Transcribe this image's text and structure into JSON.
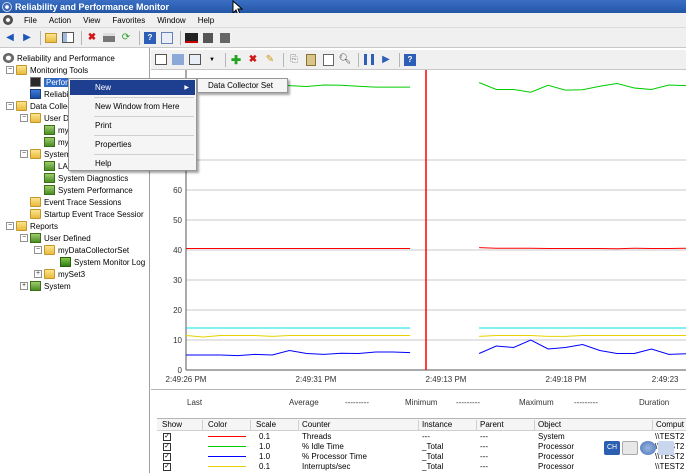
{
  "window": {
    "title": "Reliability and Performance Monitor"
  },
  "menubar": [
    "File",
    "Action",
    "View",
    "Favorites",
    "Window",
    "Help"
  ],
  "tree": {
    "root": "Reliability and Performance",
    "monitoring_tools": "Monitoring Tools",
    "performance": "Performa",
    "reliability": "Reliability",
    "data_collector_sets": "Data Collector",
    "user_defined": "User Defin",
    "my_data": "myDa",
    "my_set": "mySe",
    "system": "System",
    "lan_diag": "LAN D",
    "system_diagnostics": "System Diagnostics",
    "system_performance": "System Performance",
    "event_trace": "Event Trace Sessions",
    "startup_trace": "Startup Event Trace Sessior",
    "reports": "Reports",
    "reports_user_defined": "User Defined",
    "reports_mydcs": "myDataCollectorSet",
    "reports_sys_monitor_log": "System Monitor Log",
    "reports_myset3": "mySet3",
    "reports_system": "System"
  },
  "context_menu": {
    "items": [
      "New",
      "New Window from Here",
      "Print",
      "Properties",
      "Help"
    ],
    "submenu": "Data Collector Set"
  },
  "chart_data": {
    "type": "line",
    "y_tick_labels": [
      "70",
      "60",
      "50",
      "40",
      "30",
      "20",
      "10",
      "0"
    ],
    "ylim": [
      0,
      100
    ],
    "x_tick_labels": [
      "2:49:26 PM",
      "2:49:31 PM",
      "2:49:13 PM",
      "2:49:18 PM",
      "2:49:23"
    ],
    "series": [
      {
        "name": "Threads",
        "color": "#ff0000",
        "values": [
          40.5,
          40.5,
          40.5,
          40.5,
          40.5,
          40.5,
          40.5,
          40.5,
          40.5,
          40.5,
          40.5,
          40.5,
          40.5,
          40.5,
          40.5,
          40.5,
          40.5,
          40.8,
          40.6,
          40.6,
          40.6,
          40.5,
          40.5,
          40.5,
          40.5,
          40.4,
          40.6,
          40.5,
          40.5,
          40.6
        ]
      },
      {
        "name": "% Idle Time",
        "color": "#00cc00",
        "values": [
          95.5,
          94.5,
          94.8,
          95.2,
          94.6,
          95.8,
          94.8,
          94.5,
          95.0,
          94.9,
          94.6,
          94.3,
          94.3,
          94.3,
          94.3,
          95.0,
          92.0,
          95.8,
          93.5,
          93.5,
          92.6,
          94.9,
          93.3,
          93.4,
          94.6,
          95.5,
          94.0,
          93.5,
          95.0,
          94.8
        ]
      },
      {
        "name": "% Processor Time",
        "color": "#0000ff",
        "values": [
          5.0,
          5.0,
          5.0,
          4.8,
          5.2,
          5.0,
          6.5,
          5.5,
          5.2,
          5.6,
          5.5,
          6.0,
          6.0,
          5.8,
          5.8,
          5.0,
          6.0,
          5.5,
          8.0,
          7.5,
          10.0,
          7.0,
          7.5,
          8.5,
          6.5,
          5.5,
          5.5,
          7.0,
          5.2,
          5.4
        ]
      },
      {
        "name": "Interrupts/sec",
        "color": "#e6d200",
        "values": [
          11.5,
          11.0,
          11.5,
          11.5,
          11.5,
          11.2,
          11.5,
          11.5,
          11.5,
          11.5,
          11.5,
          11.5,
          11.5,
          11.5,
          11.5,
          11.5,
          11.0,
          11.2,
          11.5,
          11.5,
          11.5,
          11.2,
          11.2,
          11.5,
          11.5,
          11.5,
          11.5,
          11.5,
          11.5,
          11.5
        ]
      },
      {
        "name": "cyan",
        "color": "#00e5e5",
        "values": [
          14,
          14,
          14,
          14,
          14,
          14,
          14,
          14,
          14,
          14,
          14,
          14,
          14,
          14,
          14,
          14,
          14,
          14,
          14,
          14,
          14,
          14,
          14,
          14,
          14,
          14,
          14,
          14,
          14,
          14
        ]
      }
    ]
  },
  "stats": {
    "last_label": "Last",
    "last_value": "",
    "average_label": "Average",
    "average_value": "---------",
    "minimum_label": "Minimum",
    "minimum_value": "---------",
    "maximum_label": "Maximum",
    "maximum_value": "---------",
    "duration_label": "Duration"
  },
  "legend": {
    "headers": [
      "Show",
      "Color",
      "Scale",
      "Counter",
      "Instance",
      "Parent",
      "Object",
      "Comput"
    ],
    "rows": [
      {
        "show": "✓",
        "color": "#ff0000",
        "scale": "0.1",
        "counter": "Threads",
        "instance": "---",
        "parent": "---",
        "object": "System",
        "computer": "\\\\TEST2"
      },
      {
        "show": "✓",
        "color": "#00cc00",
        "scale": "1.0",
        "counter": "% Idle Time",
        "instance": "_Total",
        "parent": "---",
        "object": "Processor",
        "computer": "\\\\TEST2"
      },
      {
        "show": "✓",
        "color": "#0000ff",
        "scale": "1.0",
        "counter": "% Processor Time",
        "instance": "_Total",
        "parent": "---",
        "object": "Processor",
        "computer": "\\\\TEST2"
      },
      {
        "show": "✓",
        "color": "#e6d200",
        "scale": "0.1",
        "counter": "Interrupts/sec",
        "instance": "_Total",
        "parent": "---",
        "object": "Processor",
        "computer": "\\\\TEST2"
      }
    ]
  }
}
